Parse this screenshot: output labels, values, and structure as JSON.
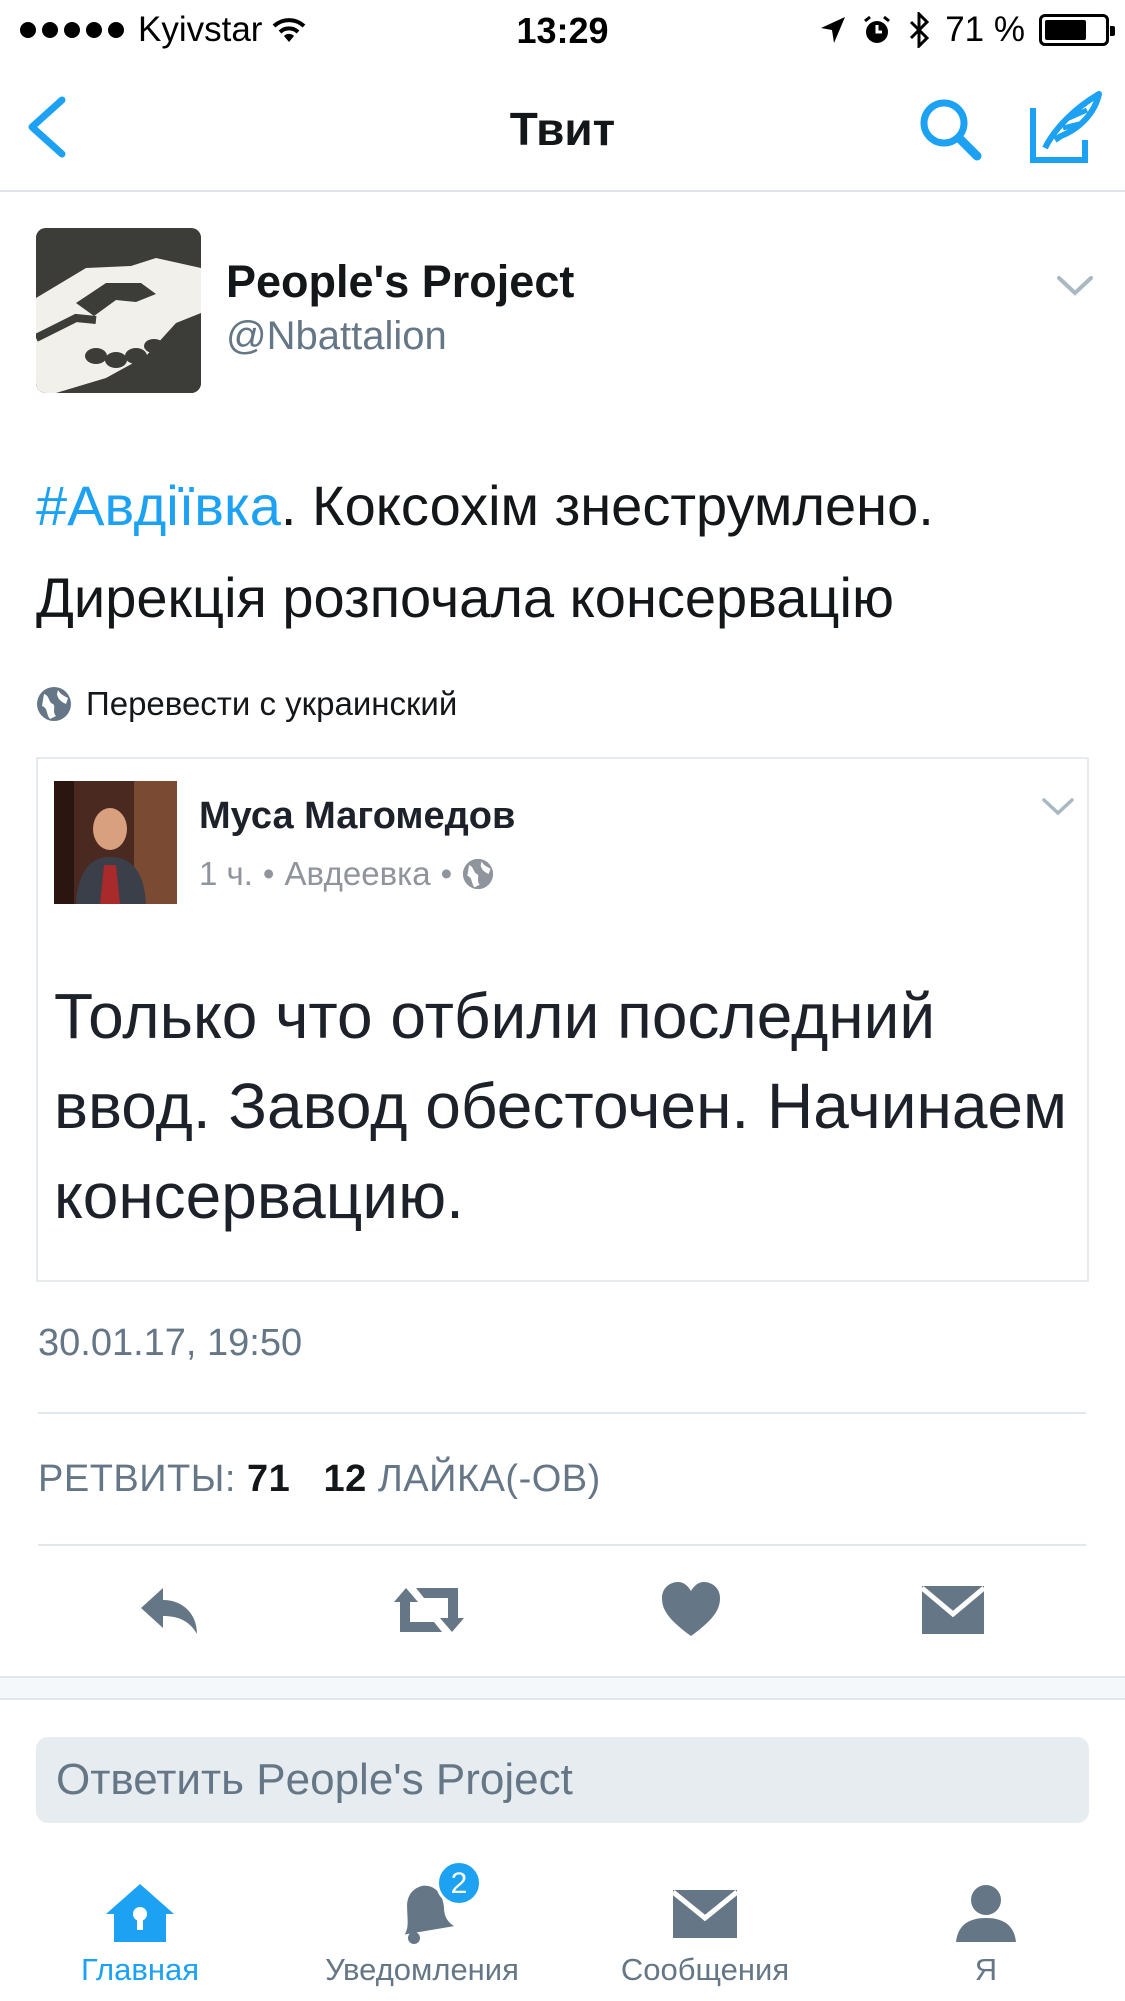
{
  "status_bar": {
    "carrier": "Kyivstar",
    "time": "13:29",
    "battery": "71 %",
    "battery_level": 0.71
  },
  "nav": {
    "title": "Твит"
  },
  "tweet": {
    "author_name": "People's Project",
    "author_handle": "@Nbattalion",
    "hashtag": "#Авдіївка",
    "text_rest": ". Коксохім знеструмлено. Дирекція розпочала консервацію",
    "translate_label": "Перевести с украинский",
    "timestamp": "30.01.17, 19:50",
    "retweets_label": "РЕТВИТЫ:",
    "retweets_count": "71",
    "likes_count": "12",
    "likes_label": "ЛАЙКА(-ОВ)"
  },
  "embedded_post": {
    "author": "Муса Магомедов",
    "time": "1 ч.",
    "location": "Авдеевка",
    "separator": "•",
    "text": "Только что отбили последний ввод. Завод обесточен. Начинаем консервацию."
  },
  "reply": {
    "placeholder": "Ответить People's Project"
  },
  "tabbar": {
    "tabs": [
      {
        "label": "Главная",
        "icon": "home-icon"
      },
      {
        "label": "Уведомления",
        "icon": "bell-icon",
        "badge": "2"
      },
      {
        "label": "Сообщения",
        "icon": "envelope-icon"
      },
      {
        "label": "Я",
        "icon": "person-icon"
      }
    ]
  },
  "colors": {
    "accent": "#1da1f2",
    "secondary_text": "#657786",
    "primary_text": "#14171a"
  }
}
